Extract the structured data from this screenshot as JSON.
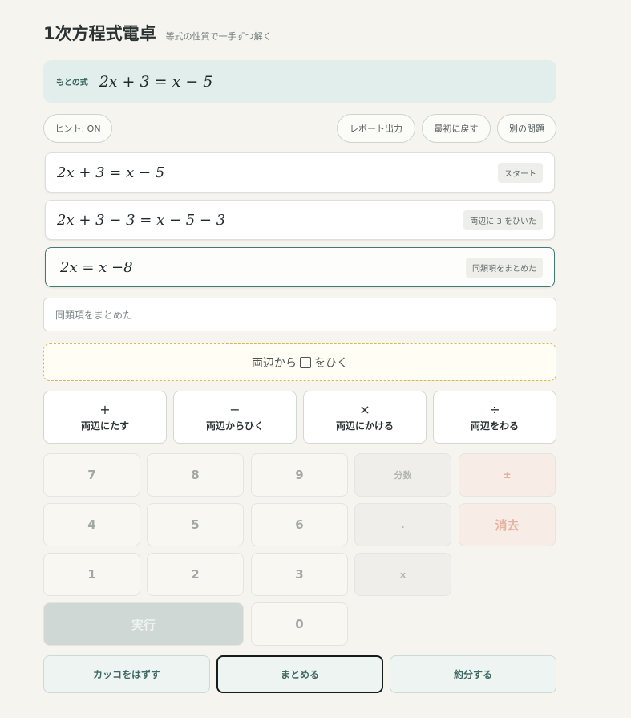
{
  "header": {
    "title": "1次方程式電卓",
    "subtitle": "等式の性質で一手ずつ解く"
  },
  "original": {
    "label": "もとの式",
    "equation": "2x + 3 = x − 5"
  },
  "toolbar": {
    "hint": "ヒント: ON",
    "report": "レポート出力",
    "reset": "最初に戻す",
    "new_problem": "別の問題"
  },
  "steps": [
    {
      "equation": "2x + 3 = x − 5",
      "tag": "スタート"
    },
    {
      "equation": "2x + 3 − 3 = x − 5 − 3",
      "tag": "両辺に 3 をひいた"
    },
    {
      "equation": "2x  =  x  −8",
      "tag": "同類項をまとめた"
    }
  ],
  "note_text": "同類項をまとめた",
  "op_prompt": {
    "before": "両辺から",
    "after": "をひく"
  },
  "ops": [
    {
      "symbol": "+",
      "label": "両辺にたす"
    },
    {
      "symbol": "−",
      "label": "両辺からひく"
    },
    {
      "symbol": "×",
      "label": "両辺にかける"
    },
    {
      "symbol": "÷",
      "label": "両辺をわる"
    }
  ],
  "keys": {
    "k7": "7",
    "k8": "8",
    "k9": "9",
    "fraction": "分数",
    "plusminus": "±",
    "k4": "4",
    "k5": "5",
    "k6": "6",
    "dot": ".",
    "clear": "消去",
    "k1": "1",
    "k2": "2",
    "k3": "3",
    "x": "x",
    "execute": "実行",
    "k0": "0"
  },
  "bottom": {
    "expand": "カッコをはずす",
    "combine": "まとめる",
    "reduce": "約分する"
  }
}
